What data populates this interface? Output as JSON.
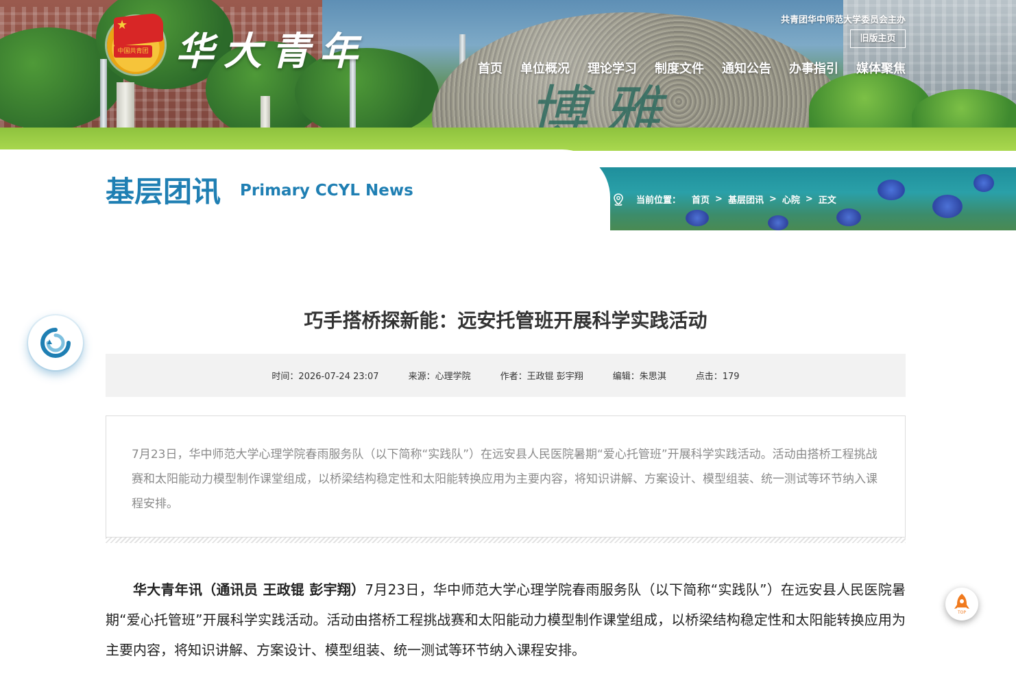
{
  "header": {
    "brand_name": "华大青年",
    "emblem_text": "中国共青团",
    "sponsor_text": "共青团华中师范大学委员会主办",
    "old_home_label": "旧版主页",
    "nav": [
      "首页",
      "单位概况",
      "理论学习",
      "制度文件",
      "通知公告",
      "办事指引",
      "媒体聚焦"
    ],
    "rock_inscription": "博雅"
  },
  "section": {
    "title": "基层团讯",
    "title_en": "Primary CCYL News"
  },
  "breadcrumb": {
    "label": "当前位置：",
    "items": [
      "首页",
      "基层团讯",
      "心院",
      "正文"
    ],
    "separator": ">"
  },
  "article": {
    "title": "巧手搭桥探新能：远安托管班开展科学实践活动",
    "meta": {
      "time": "时间：2026-07-24 23:07",
      "source": "来源：心理学院",
      "author": "作者：王政锟 彭宇翔",
      "editor": "编辑：朱思淇",
      "clicks": "点击：179"
    },
    "summary": "7月23日，华中师范大学心理学院春雨服务队（以下简称“实践队”）在远安县人民医院暑期“爱心托管班”开展科学实践活动。活动由搭桥工程挑战赛和太阳能动力模型制作课堂组成，以桥梁结构稳定性和太阳能转换应用为主要内容，将知识讲解、方案设计、模型组装、统一测试等环节纳入课程安排。",
    "body_lead": "华大青年讯（通讯员 王政锟 彭宇翔）",
    "body_rest": "7月23日，华中师范大学心理学院春雨服务队（以下简称“实践队”）在远安县人民医院暑期“爱心托管班”开展科学实践活动。活动由搭桥工程挑战赛和太阳能动力模型制作课堂组成，以桥梁结构稳定性和太阳能转换应用为主要内容，将知识讲解、方案设计、模型组装、统一测试等环节纳入课程安排。"
  },
  "widgets": {
    "left_icon": "refresh-icon",
    "right_icon": "rocket-icon",
    "rocket_label": "TOP"
  },
  "colors": {
    "brand_blue": "#1f7fb3",
    "meta_bg": "#f2f2f2",
    "summary_text": "#8a8a8a",
    "rocket_orange": "#f07a1e"
  }
}
